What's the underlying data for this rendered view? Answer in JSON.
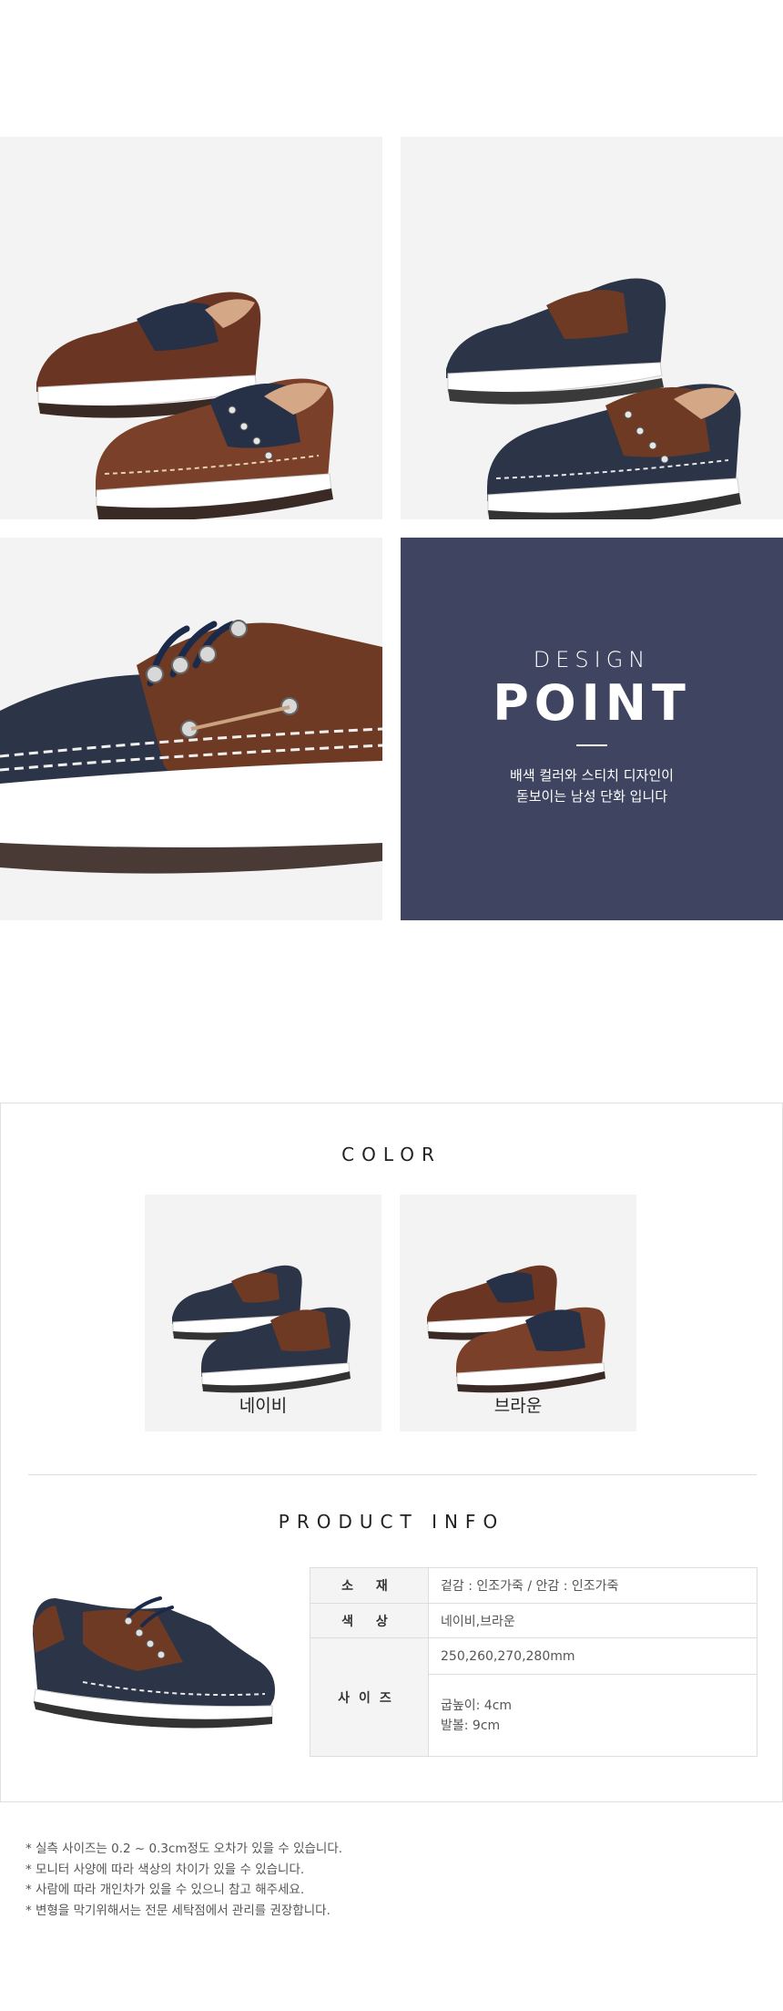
{
  "design_point": {
    "eyebrow": "DESIGN",
    "title": "POINT",
    "description_line1": "배색 컬러와 스티치 디자인이",
    "description_line2": "돋보이는 남성 단화 입니다"
  },
  "color_section": {
    "title": "COLOR",
    "options": [
      {
        "label": "네이비"
      },
      {
        "label": "브라운"
      }
    ]
  },
  "product_info": {
    "title": "PRODUCT INFO",
    "rows": [
      {
        "key": "소 재",
        "value": "겉감 : 인조가죽 / 안감 : 인조가죽"
      },
      {
        "key": "색 상",
        "value": "네이비,브라운"
      },
      {
        "key": "사이즈",
        "value": "250,260,270,280mm",
        "extra1": "굽높이: 4cm",
        "extra2": "발볼: 9cm"
      }
    ]
  },
  "notes": [
    "* 실측 사이즈는 0.2 ~ 0.3cm정도 오차가 있을 수 있습니다.",
    "* 모니터 사양에 따라 색상의 차이가 있을 수 있습니다.",
    "* 사람에 따라 개인차가 있을 수 있으니 참고 해주세요.",
    "* 변형을 막기위해서는 전문 세탁점에서 관리를 권장합니다."
  ],
  "colors": {
    "navy": "#2c3447",
    "brown": "#6e3a24",
    "panel_bg": "#f3f3f3",
    "design_panel": "#3f4560"
  }
}
